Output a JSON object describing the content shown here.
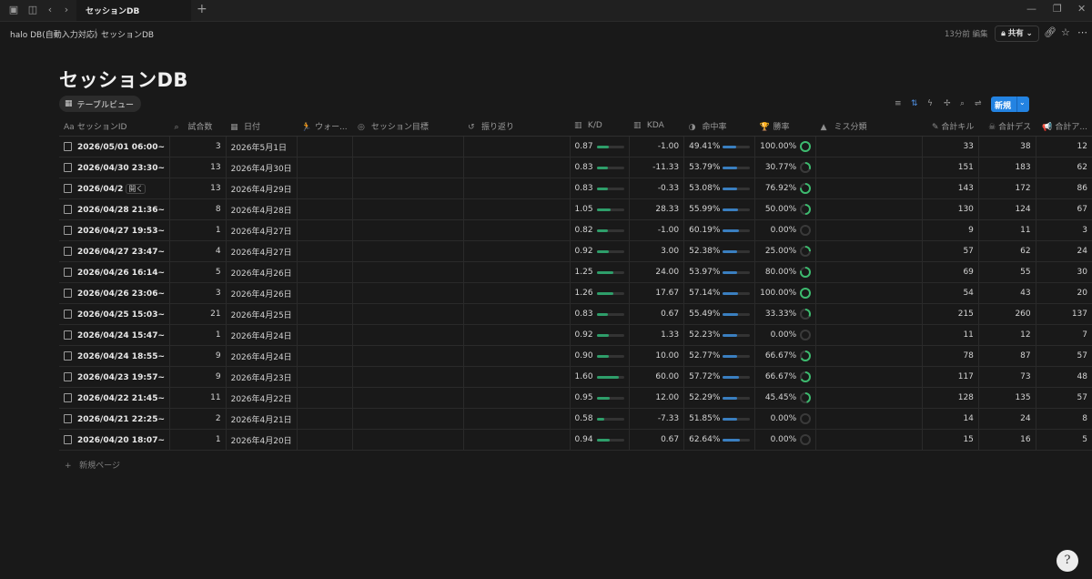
{
  "tabbar": {
    "tab_title": "セッションDB"
  },
  "breadcrumb": {
    "parent": "halo DB(自動入力対応)",
    "current": "セッションDB"
  },
  "topbar": {
    "edited": "13分前 編集",
    "share": "共有"
  },
  "page": {
    "title": "セッションDB",
    "view_label": "テーブルビュー",
    "new_button": "新規",
    "new_page": "新規ページ"
  },
  "columns": [
    {
      "icon": "Aa",
      "label": "セッションID"
    },
    {
      "icon": "⌕",
      "label": "試合数"
    },
    {
      "icon": "▦",
      "label": "日付"
    },
    {
      "icon": "🏃",
      "label": "ウォー..."
    },
    {
      "icon": "◎",
      "label": "セッション目標"
    },
    {
      "icon": "↺",
      "label": "振り返り"
    },
    {
      "icon": "▥",
      "label": "K/D"
    },
    {
      "icon": "▥",
      "label": "KDA"
    },
    {
      "icon": "◑",
      "label": "命中率"
    },
    {
      "icon": "🏆",
      "label": "勝率"
    },
    {
      "icon": "▲",
      "label": "ミス分類"
    },
    {
      "icon": "✎",
      "label": "合計キル"
    },
    {
      "icon": "☠",
      "label": "合計デス"
    },
    {
      "icon": "📢",
      "label": "合計ア..."
    }
  ],
  "rows": [
    {
      "id": "2026/05/01 06:00~",
      "matches": "3",
      "date": "2026年5月1日",
      "kd": "0.87",
      "kd_ratio": 0.44,
      "kda": "-1.00",
      "acc": "49.41%",
      "acc_ratio": 0.49,
      "win": "100.00%",
      "win_ratio": 1.0,
      "kills": "33",
      "deaths": "38",
      "assists": "12"
    },
    {
      "id": "2026/04/30 23:30~",
      "matches": "13",
      "date": "2026年4月30日",
      "kd": "0.83",
      "kd_ratio": 0.42,
      "kda": "-11.33",
      "acc": "53.79%",
      "acc_ratio": 0.54,
      "win": "30.77%",
      "win_ratio": 0.31,
      "kills": "151",
      "deaths": "183",
      "assists": "62"
    },
    {
      "id": "2026/04/2",
      "matches": "13",
      "date": "2026年4月29日",
      "kd": "0.83",
      "kd_ratio": 0.42,
      "kda": "-0.33",
      "acc": "53.08%",
      "acc_ratio": 0.53,
      "win": "76.92%",
      "win_ratio": 0.77,
      "kills": "143",
      "deaths": "172",
      "assists": "86",
      "hover": true,
      "open_label": "開く"
    },
    {
      "id": "2026/04/28 21:36~",
      "matches": "8",
      "date": "2026年4月28日",
      "kd": "1.05",
      "kd_ratio": 0.53,
      "kda": "28.33",
      "acc": "55.99%",
      "acc_ratio": 0.56,
      "win": "50.00%",
      "win_ratio": 0.5,
      "kills": "130",
      "deaths": "124",
      "assists": "67"
    },
    {
      "id": "2026/04/27 19:53~",
      "matches": "1",
      "date": "2026年4月27日",
      "kd": "0.82",
      "kd_ratio": 0.41,
      "kda": "-1.00",
      "acc": "60.19%",
      "acc_ratio": 0.6,
      "win": "0.00%",
      "win_ratio": 0.0,
      "kills": "9",
      "deaths": "11",
      "assists": "3"
    },
    {
      "id": "2026/04/27 23:47~",
      "matches": "4",
      "date": "2026年4月27日",
      "kd": "0.92",
      "kd_ratio": 0.46,
      "kda": "3.00",
      "acc": "52.38%",
      "acc_ratio": 0.52,
      "win": "25.00%",
      "win_ratio": 0.25,
      "kills": "57",
      "deaths": "62",
      "assists": "24"
    },
    {
      "id": "2026/04/26 16:14~",
      "matches": "5",
      "date": "2026年4月26日",
      "kd": "1.25",
      "kd_ratio": 0.63,
      "kda": "24.00",
      "acc": "53.97%",
      "acc_ratio": 0.54,
      "win": "80.00%",
      "win_ratio": 0.8,
      "kills": "69",
      "deaths": "55",
      "assists": "30"
    },
    {
      "id": "2026/04/26 23:06~",
      "matches": "3",
      "date": "2026年4月26日",
      "kd": "1.26",
      "kd_ratio": 0.63,
      "kda": "17.67",
      "acc": "57.14%",
      "acc_ratio": 0.57,
      "win": "100.00%",
      "win_ratio": 1.0,
      "kills": "54",
      "deaths": "43",
      "assists": "20"
    },
    {
      "id": "2026/04/25 15:03~",
      "matches": "21",
      "date": "2026年4月25日",
      "kd": "0.83",
      "kd_ratio": 0.42,
      "kda": "0.67",
      "acc": "55.49%",
      "acc_ratio": 0.55,
      "win": "33.33%",
      "win_ratio": 0.33,
      "kills": "215",
      "deaths": "260",
      "assists": "137"
    },
    {
      "id": "2026/04/24 15:47~",
      "matches": "1",
      "date": "2026年4月24日",
      "kd": "0.92",
      "kd_ratio": 0.46,
      "kda": "1.33",
      "acc": "52.23%",
      "acc_ratio": 0.52,
      "win": "0.00%",
      "win_ratio": 0.0,
      "kills": "11",
      "deaths": "12",
      "assists": "7"
    },
    {
      "id": "2026/04/24 18:55~",
      "matches": "9",
      "date": "2026年4月24日",
      "kd": "0.90",
      "kd_ratio": 0.45,
      "kda": "10.00",
      "acc": "52.77%",
      "acc_ratio": 0.53,
      "win": "66.67%",
      "win_ratio": 0.67,
      "kills": "78",
      "deaths": "87",
      "assists": "57"
    },
    {
      "id": "2026/04/23 19:57~",
      "matches": "9",
      "date": "2026年4月23日",
      "kd": "1.60",
      "kd_ratio": 0.8,
      "kda": "60.00",
      "acc": "57.72%",
      "acc_ratio": 0.58,
      "win": "66.67%",
      "win_ratio": 0.67,
      "kills": "117",
      "deaths": "73",
      "assists": "48"
    },
    {
      "id": "2026/04/22 21:45~",
      "matches": "11",
      "date": "2026年4月22日",
      "kd": "0.95",
      "kd_ratio": 0.48,
      "kda": "12.00",
      "acc": "52.29%",
      "acc_ratio": 0.52,
      "win": "45.45%",
      "win_ratio": 0.45,
      "kills": "128",
      "deaths": "135",
      "assists": "57"
    },
    {
      "id": "2026/04/21 22:25~",
      "matches": "2",
      "date": "2026年4月21日",
      "kd": "0.58",
      "kd_ratio": 0.29,
      "kda": "-7.33",
      "acc": "51.85%",
      "acc_ratio": 0.52,
      "win": "0.00%",
      "win_ratio": 0.0,
      "kills": "14",
      "deaths": "24",
      "assists": "8"
    },
    {
      "id": "2026/04/20 18:07~",
      "matches": "1",
      "date": "2026年4月20日",
      "kd": "0.94",
      "kd_ratio": 0.47,
      "kda": "0.67",
      "acc": "62.64%",
      "acc_ratio": 0.63,
      "win": "0.00%",
      "win_ratio": 0.0,
      "kills": "15",
      "deaths": "16",
      "assists": "5"
    }
  ],
  "colors": {
    "accent": "#2383e2",
    "kd_bar": "#2e9e6a",
    "acc_bar": "#3a7fc0",
    "win_ring": "#3dbb6f"
  }
}
